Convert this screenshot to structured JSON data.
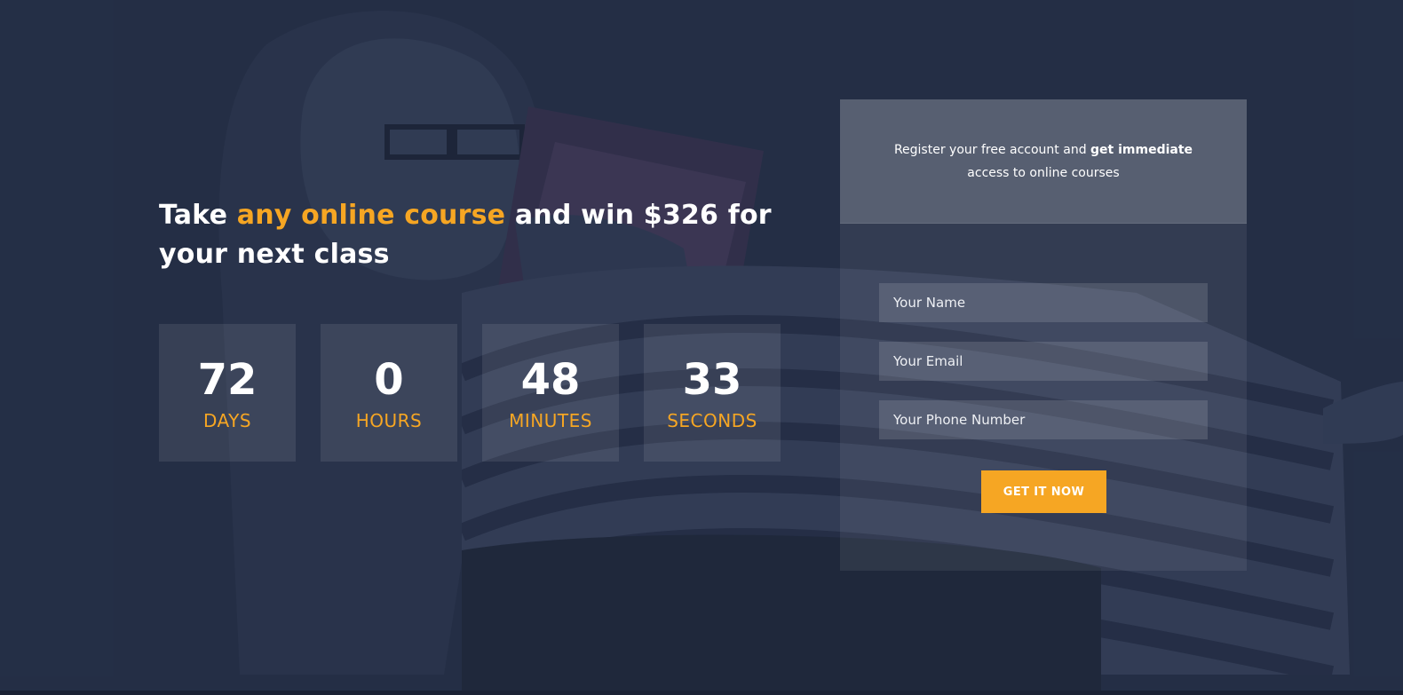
{
  "hero": {
    "headline": {
      "before": "Take ",
      "accent": "any online course",
      "after": " and win $326 for your next class"
    },
    "countdown": [
      {
        "value": "72",
        "label": "DAYS"
      },
      {
        "value": "0",
        "label": "HOURS"
      },
      {
        "value": "48",
        "label": "MINUTES"
      },
      {
        "value": "33",
        "label": "SECONDS"
      }
    ]
  },
  "signup": {
    "intro": {
      "regular": "Register your free account and ",
      "bold": "get immediate",
      "rest": " access to online courses"
    },
    "fields": {
      "name_placeholder": "Your Name",
      "email_placeholder": "Your Email",
      "phone_placeholder": "Your Phone Number"
    },
    "submit_label": "GET IT NOW"
  },
  "colors": {
    "accent": "#f6a623",
    "background": "#263045",
    "text": "#ffffff"
  }
}
